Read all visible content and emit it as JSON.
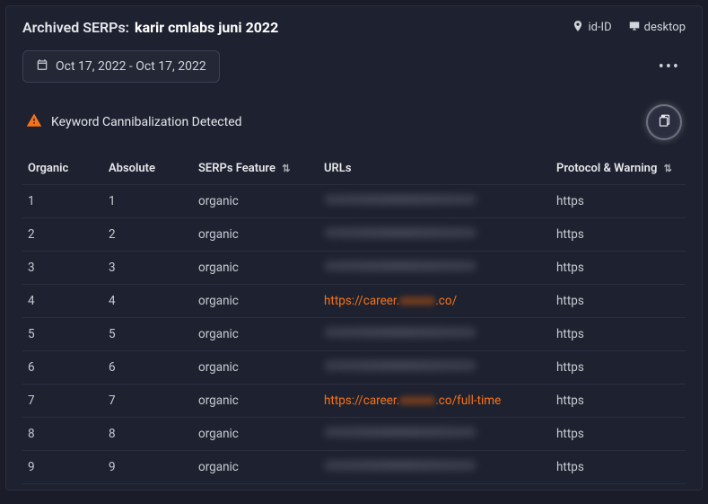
{
  "header": {
    "title_prefix": "Archived SERPs:",
    "keyword": "karir cmlabs juni 2022",
    "locale": "id-ID",
    "device": "desktop"
  },
  "date_range": "Oct 17, 2022 - Oct 17, 2022",
  "alert": {
    "text": "Keyword Cannibalization Detected"
  },
  "columns": {
    "organic": "Organic",
    "absolute": "Absolute",
    "feature": "SERPs Feature",
    "urls": "URLs",
    "protocol": "Protocol & Warning"
  },
  "rows": [
    {
      "organic": "1",
      "absolute": "1",
      "feature": "organic",
      "url_visible": false,
      "url_prefix": "",
      "url_suffix": "",
      "protocol": "https"
    },
    {
      "organic": "2",
      "absolute": "2",
      "feature": "organic",
      "url_visible": false,
      "url_prefix": "",
      "url_suffix": "",
      "protocol": "https"
    },
    {
      "organic": "3",
      "absolute": "3",
      "feature": "organic",
      "url_visible": false,
      "url_prefix": "",
      "url_suffix": "",
      "protocol": "https"
    },
    {
      "organic": "4",
      "absolute": "4",
      "feature": "organic",
      "url_visible": true,
      "url_prefix": "https://career.",
      "url_suffix": ".co/",
      "protocol": "https"
    },
    {
      "organic": "5",
      "absolute": "5",
      "feature": "organic",
      "url_visible": false,
      "url_prefix": "",
      "url_suffix": "",
      "protocol": "https"
    },
    {
      "organic": "6",
      "absolute": "6",
      "feature": "organic",
      "url_visible": false,
      "url_prefix": "",
      "url_suffix": "",
      "protocol": "https"
    },
    {
      "organic": "7",
      "absolute": "7",
      "feature": "organic",
      "url_visible": true,
      "url_prefix": "https://career.",
      "url_suffix": ".co/full-time",
      "protocol": "https"
    },
    {
      "organic": "8",
      "absolute": "8",
      "feature": "organic",
      "url_visible": false,
      "url_prefix": "",
      "url_suffix": "",
      "protocol": "https"
    },
    {
      "organic": "9",
      "absolute": "9",
      "feature": "organic",
      "url_visible": false,
      "url_prefix": "",
      "url_suffix": "",
      "protocol": "https"
    }
  ]
}
